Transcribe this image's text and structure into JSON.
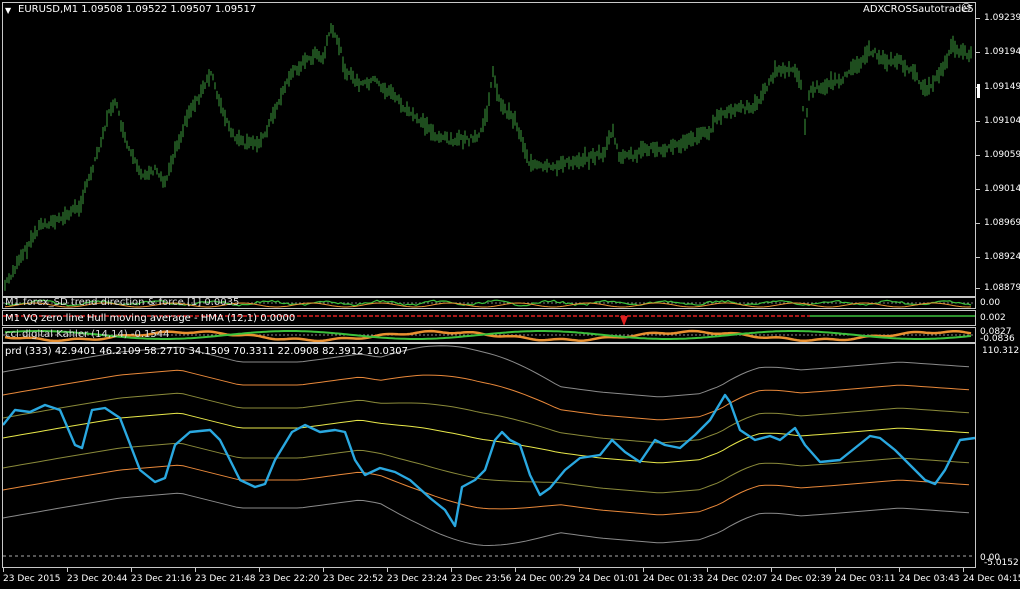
{
  "main_chart": {
    "symbol_line": "EURUSD,M1  1.09508 1.09522 1.09507 1.09517",
    "expert_name": "ADXCROSSautotrade5",
    "price_axis": [
      "1.09239",
      "1.09194",
      "1.09149",
      "1.09104",
      "1.09059",
      "1.09014",
      "1.08969",
      "1.08924",
      "1.08879"
    ]
  },
  "indicator_1": {
    "label": "M1 forex_SD trend direction & force [1] 0.0035",
    "axis": [
      "0.00"
    ]
  },
  "indicator_2": {
    "label": "M1 VQ zero line Hull moving average - HMA (12,1) 0.0000",
    "axis": [
      "0.002"
    ]
  },
  "indicator_3": {
    "label": "cci digital Kahler (14,14) -0.1544",
    "axis": [
      "0.0827",
      "-0.0836"
    ]
  },
  "indicator_4": {
    "label": "prd  (333) 42.9401 46.2109 58.2710 34.1509 70.3311 22.0908 82.3912 10.0307",
    "axis_top": "110.3128",
    "axis_bottom_a": "0.00",
    "axis_bottom_b": "-5.0152"
  },
  "time_axis": [
    "23 Dec 2015",
    "23 Dec 20:44",
    "23 Dec 21:16",
    "23 Dec 21:48",
    "23 Dec 22:20",
    "23 Dec 22:52",
    "23 Dec 23:24",
    "23 Dec 23:56",
    "24 Dec 00:29",
    "24 Dec 01:01",
    "24 Dec 01:33",
    "24 Dec 02:07",
    "24 Dec 02:39",
    "24 Dec 03:11",
    "24 Dec 03:43",
    "24 Dec 04:15"
  ],
  "colors": {
    "candle": "#3c9a3c",
    "cyan": "#2aa8e0",
    "band_yellow": "#e8e84a",
    "band_orange": "#e8883a",
    "band_olive": "#8a8a3a",
    "band_gray": "#8a8a8a",
    "red": "#e02020",
    "green": "#3cc03c",
    "orange": "#e89030"
  }
}
